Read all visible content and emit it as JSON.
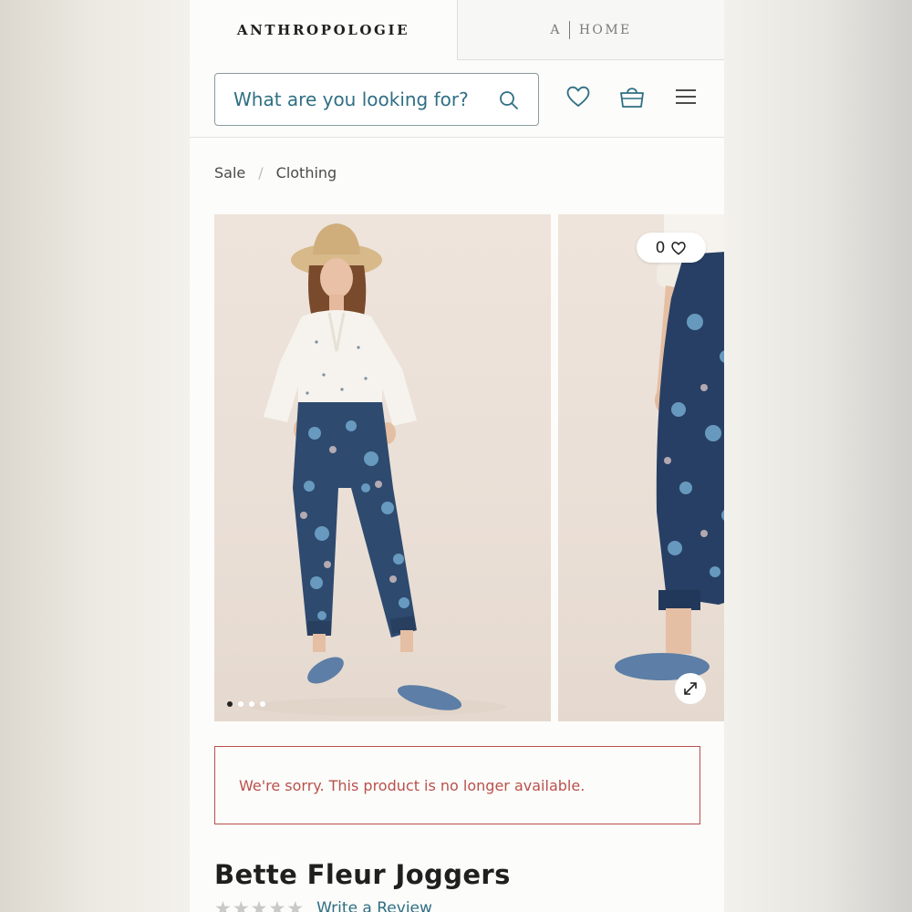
{
  "brand_tabs": {
    "main_label": "ANTHROPOLOGIE",
    "home_prefix": "A",
    "home_label": "HOME"
  },
  "header": {
    "search_placeholder": "What are you looking for?",
    "icons": [
      "search-icon",
      "heart-icon",
      "shopping-bag-icon",
      "hamburger-menu-icon"
    ]
  },
  "breadcrumb": {
    "items": [
      "Sale",
      "Clothing"
    ],
    "separator": "/"
  },
  "gallery": {
    "favorite_count": "0",
    "image_count": 4,
    "active_image_index": 0,
    "icons": [
      "heart-icon",
      "expand-icon"
    ]
  },
  "alert": {
    "message": "We're sorry. This product is no longer available."
  },
  "product": {
    "title": "Bette Fleur Joggers",
    "rating_stars_filled": 0,
    "rating_stars_total": 5,
    "review_link": "Write a Review"
  },
  "colors": {
    "accent_teal": "#2f6f83",
    "alert_red": "#b8514c",
    "text_dark": "#1f1f1f"
  }
}
